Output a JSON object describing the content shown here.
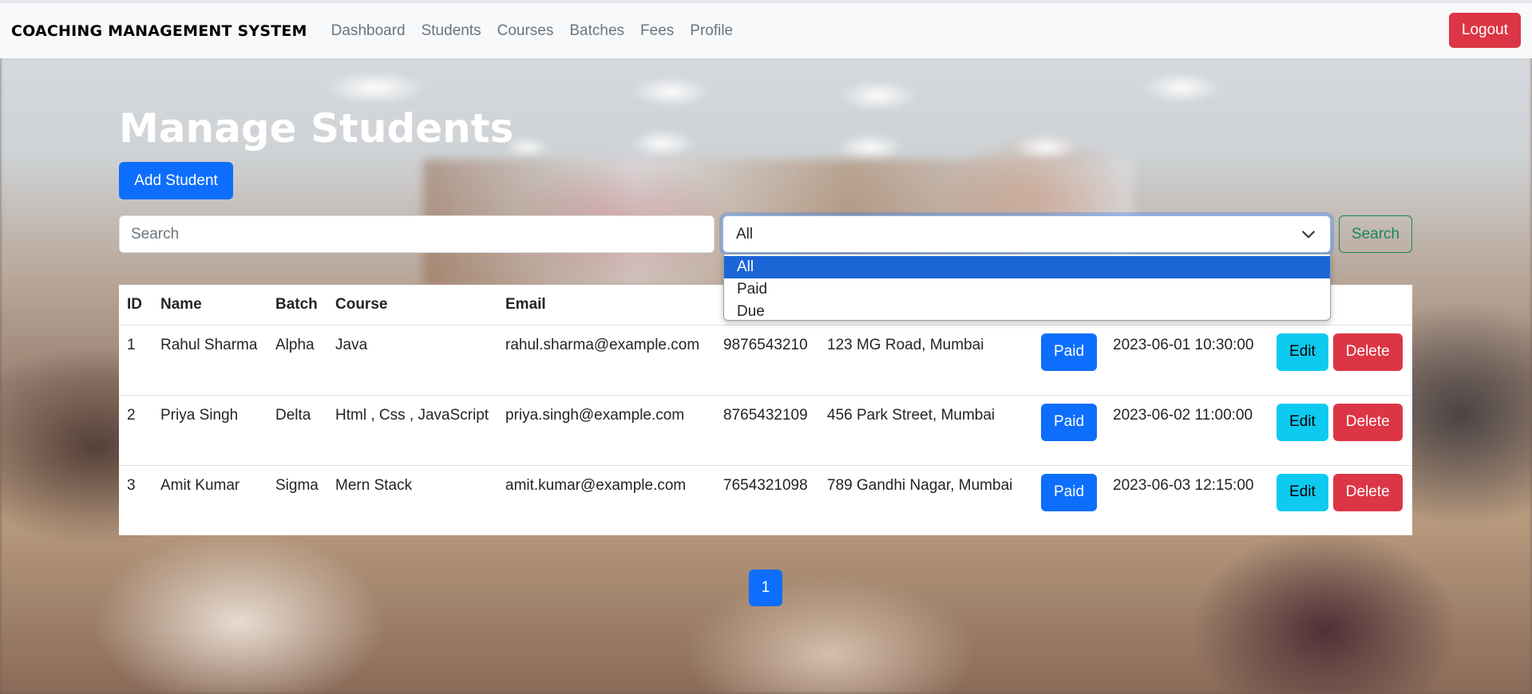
{
  "nav": {
    "brand": "COACHING MANAGEMENT SYSTEM",
    "links": [
      "Dashboard",
      "Students",
      "Courses",
      "Batches",
      "Fees",
      "Profile"
    ],
    "logout": "Logout"
  },
  "page": {
    "title": "Manage Students",
    "add_button": "Add Student"
  },
  "filters": {
    "search_placeholder": "Search",
    "search_value": "",
    "fee_status_selected": "All",
    "fee_status_options": [
      "All",
      "Paid",
      "Due"
    ],
    "search_button": "Search"
  },
  "table": {
    "headers": [
      "ID",
      "Name",
      "Batch",
      "Course",
      "Email",
      "",
      "",
      "",
      "",
      ""
    ],
    "rows": [
      {
        "id": "1",
        "name": "Rahul Sharma",
        "batch": "Alpha",
        "course": "Java",
        "email": "rahul.sharma@example.com",
        "phone": "9876543210",
        "address": "123 MG Road, Mumbai",
        "fee_status": "Paid",
        "date": "2023-06-01 10:30:00",
        "edit": "Edit",
        "delete": "Delete"
      },
      {
        "id": "2",
        "name": "Priya Singh",
        "batch": "Delta",
        "course": "Html , Css , JavaScript",
        "email": "priya.singh@example.com",
        "phone": "8765432109",
        "address": "456 Park Street, Mumbai",
        "fee_status": "Paid",
        "date": "2023-06-02 11:00:00",
        "edit": "Edit",
        "delete": "Delete"
      },
      {
        "id": "3",
        "name": "Amit Kumar",
        "batch": "Sigma",
        "course": "Mern Stack",
        "email": "amit.kumar@example.com",
        "phone": "7654321098",
        "address": "789 Gandhi Nagar, Mumbai",
        "fee_status": "Paid",
        "date": "2023-06-03 12:15:00",
        "edit": "Edit",
        "delete": "Delete"
      }
    ]
  },
  "pagination": {
    "current": "1"
  },
  "colors": {
    "primary": "#0d6efd",
    "danger": "#dc3545",
    "info": "#0dcaf0",
    "success": "#198754"
  }
}
